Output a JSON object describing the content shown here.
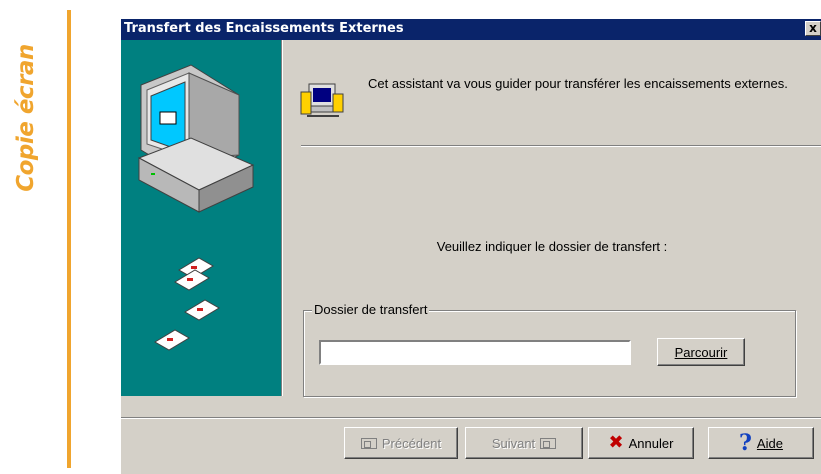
{
  "watermark": {
    "text": "Copie écran"
  },
  "dialog": {
    "title": "Transfert des Encaissements Externes",
    "close_label": "x",
    "intro": "Cet assistant va vous guider pour transférer les encaissements externes.",
    "prompt": "Veuillez indiquer le dossier de transfert :",
    "group_label": "Dossier de transfert",
    "folder_value": "",
    "browse_label": "Parcourir",
    "buttons": {
      "previous": "Précédent",
      "next": "Suivant",
      "cancel": "Annuler",
      "help": "Aide"
    }
  },
  "colors": {
    "titlebar": "#0a246a",
    "side_panel": "#008080",
    "watermark": "#f0a52e",
    "window_bg": "#d4d0c8"
  },
  "icons": [
    "computer-icon",
    "floppy-disk-icon",
    "wizard-icon",
    "close-icon",
    "cancel-x-icon",
    "help-question-icon"
  ]
}
